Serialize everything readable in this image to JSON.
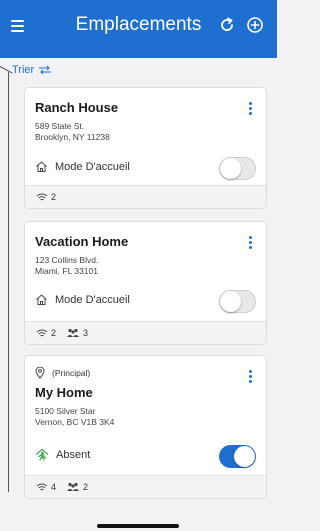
{
  "header": {
    "title": "Emplacements",
    "bg_color": "#1f6fd1",
    "menu_icon": "hamburger-icon",
    "refresh_icon": "refresh-icon",
    "add_icon": "add-circle-icon"
  },
  "sort": {
    "label": "Trier",
    "icon": "sort-swap-icon"
  },
  "cards": [
    {
      "name": "Ranch House",
      "address_line1": "589 State St.",
      "address_line2": "Brooklyn, NY 11238",
      "mode_label": "Mode D'accueil",
      "mode_on": false,
      "wifi_count": "2"
    },
    {
      "name": "Vacation Home",
      "address_line1": "123 Collins Blvd.",
      "address_line2": "Miami, FL 33101",
      "mode_label": "Mode D'accueil",
      "mode_on": false,
      "wifi_count": "2",
      "users_count": "3"
    },
    {
      "principal_label": "(Principal)",
      "name": "My Home",
      "address_line1": "5100 Silver Star",
      "address_line2": "Vernon, BC V1B 3K4",
      "mode_label": "Absent",
      "mode_on": true,
      "wifi_count": "4",
      "users_count": "2"
    }
  ]
}
